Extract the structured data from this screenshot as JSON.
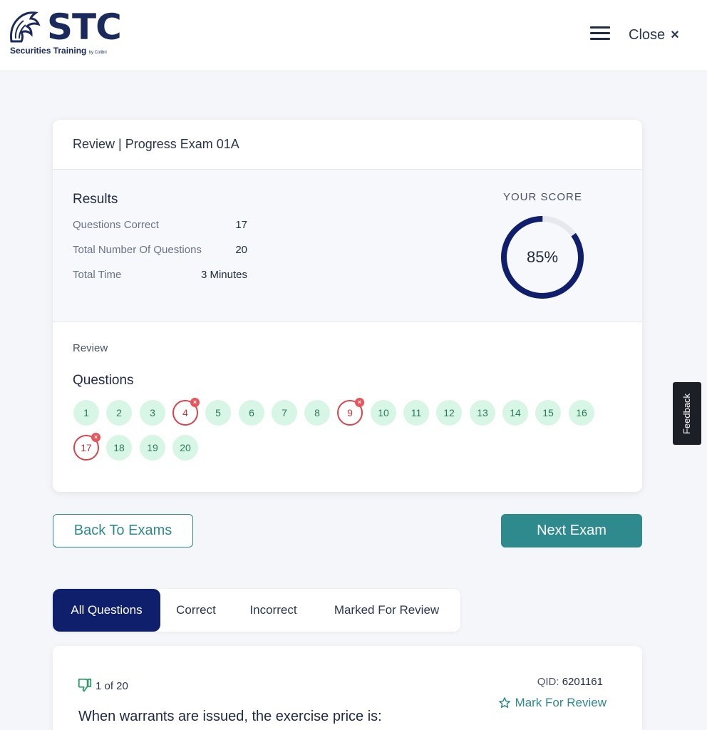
{
  "header": {
    "logo_text": "STC",
    "logo_subtitle": "Securities Training",
    "logo_byline": "by Colibri",
    "close_label": "Close",
    "close_icon": "×"
  },
  "card": {
    "title": "Review | Progress Exam 01A",
    "results_title": "Results",
    "stats": [
      {
        "label": "Questions Correct",
        "value": "17"
      },
      {
        "label": "Total Number Of Questions",
        "value": "20"
      },
      {
        "label": "Total Time",
        "value": "3 Minutes"
      }
    ],
    "score_label": "YOUR SCORE",
    "score_value": "85%",
    "score_fraction": 0.85,
    "review_label": "Review",
    "questions_label": "Questions",
    "questions": [
      {
        "n": "1",
        "status": "correct"
      },
      {
        "n": "2",
        "status": "correct"
      },
      {
        "n": "3",
        "status": "correct"
      },
      {
        "n": "4",
        "status": "incorrect"
      },
      {
        "n": "5",
        "status": "correct"
      },
      {
        "n": "6",
        "status": "correct"
      },
      {
        "n": "7",
        "status": "correct"
      },
      {
        "n": "8",
        "status": "correct"
      },
      {
        "n": "9",
        "status": "incorrect"
      },
      {
        "n": "10",
        "status": "correct"
      },
      {
        "n": "11",
        "status": "correct"
      },
      {
        "n": "12",
        "status": "correct"
      },
      {
        "n": "13",
        "status": "correct"
      },
      {
        "n": "14",
        "status": "correct"
      },
      {
        "n": "15",
        "status": "correct"
      },
      {
        "n": "16",
        "status": "correct"
      },
      {
        "n": "17",
        "status": "incorrect"
      },
      {
        "n": "18",
        "status": "correct"
      },
      {
        "n": "19",
        "status": "correct"
      },
      {
        "n": "20",
        "status": "correct"
      }
    ]
  },
  "buttons": {
    "back": "Back To Exams",
    "next": "Next Exam"
  },
  "tabs": [
    {
      "label": "All Questions",
      "active": true
    },
    {
      "label": "Correct",
      "active": false
    },
    {
      "label": "Incorrect",
      "active": false
    },
    {
      "label": "Marked For Review",
      "active": false
    }
  ],
  "question_card": {
    "counter": "1 of 20",
    "qid_label": "QID:",
    "qid_value": "6201161",
    "mark_review": "Mark For Review",
    "text": "When warrants are issued, the exercise price is:"
  },
  "feedback_label": "Feedback",
  "colors": {
    "brand_navy": "#0f1f6b",
    "teal": "#2e8a8c",
    "correct_bg": "#d8f6e6",
    "incorrect": "#d9434b"
  }
}
